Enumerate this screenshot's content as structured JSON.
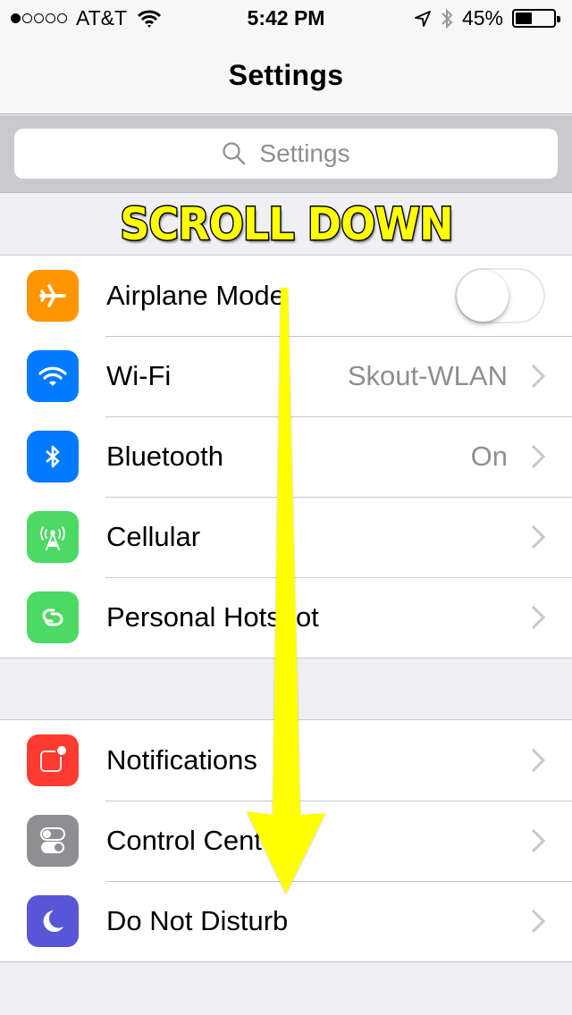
{
  "status_bar": {
    "signal_bars_filled": 1,
    "signal_bars_total": 5,
    "carrier": "AT&T",
    "time": "5:42 PM",
    "battery_percent": "45%",
    "battery_level": 0.45,
    "icons": [
      "wifi-icon",
      "location-arrow-icon",
      "bluetooth-icon",
      "battery-icon"
    ]
  },
  "nav": {
    "title": "Settings"
  },
  "search": {
    "placeholder": "Settings",
    "icon": "search-icon"
  },
  "annotation": {
    "banner_text": "SCROLL DOWN",
    "arrow": "down-arrow"
  },
  "groups": [
    {
      "rows": [
        {
          "id": "airplane-mode",
          "label": "Airplane Mode",
          "icon": "airplane-icon",
          "icon_color": "#ff9500",
          "control": "toggle",
          "toggle_on": false
        },
        {
          "id": "wifi",
          "label": "Wi-Fi",
          "icon": "wifi-icon",
          "icon_color": "#007aff",
          "value": "Skout-WLAN",
          "control": "chevron"
        },
        {
          "id": "bluetooth",
          "label": "Bluetooth",
          "icon": "bluetooth-icon",
          "icon_color": "#007aff",
          "value": "On",
          "control": "chevron"
        },
        {
          "id": "cellular",
          "label": "Cellular",
          "icon": "cellular-antenna-icon",
          "icon_color": "#4cd964",
          "control": "chevron"
        },
        {
          "id": "personal-hotspot",
          "label": "Personal Hotspot",
          "icon": "hotspot-link-icon",
          "icon_color": "#4cd964",
          "control": "chevron"
        }
      ]
    },
    {
      "rows": [
        {
          "id": "notifications",
          "label": "Notifications",
          "icon": "notifications-icon",
          "icon_color": "#ff3b30",
          "control": "chevron"
        },
        {
          "id": "control-center",
          "label": "Control Center",
          "icon": "control-center-icon",
          "icon_color": "#8e8e93",
          "control": "chevron"
        },
        {
          "id": "do-not-disturb",
          "label": "Do Not Disturb",
          "icon": "moon-icon",
          "icon_color": "#5856d6",
          "control": "chevron"
        }
      ]
    }
  ]
}
